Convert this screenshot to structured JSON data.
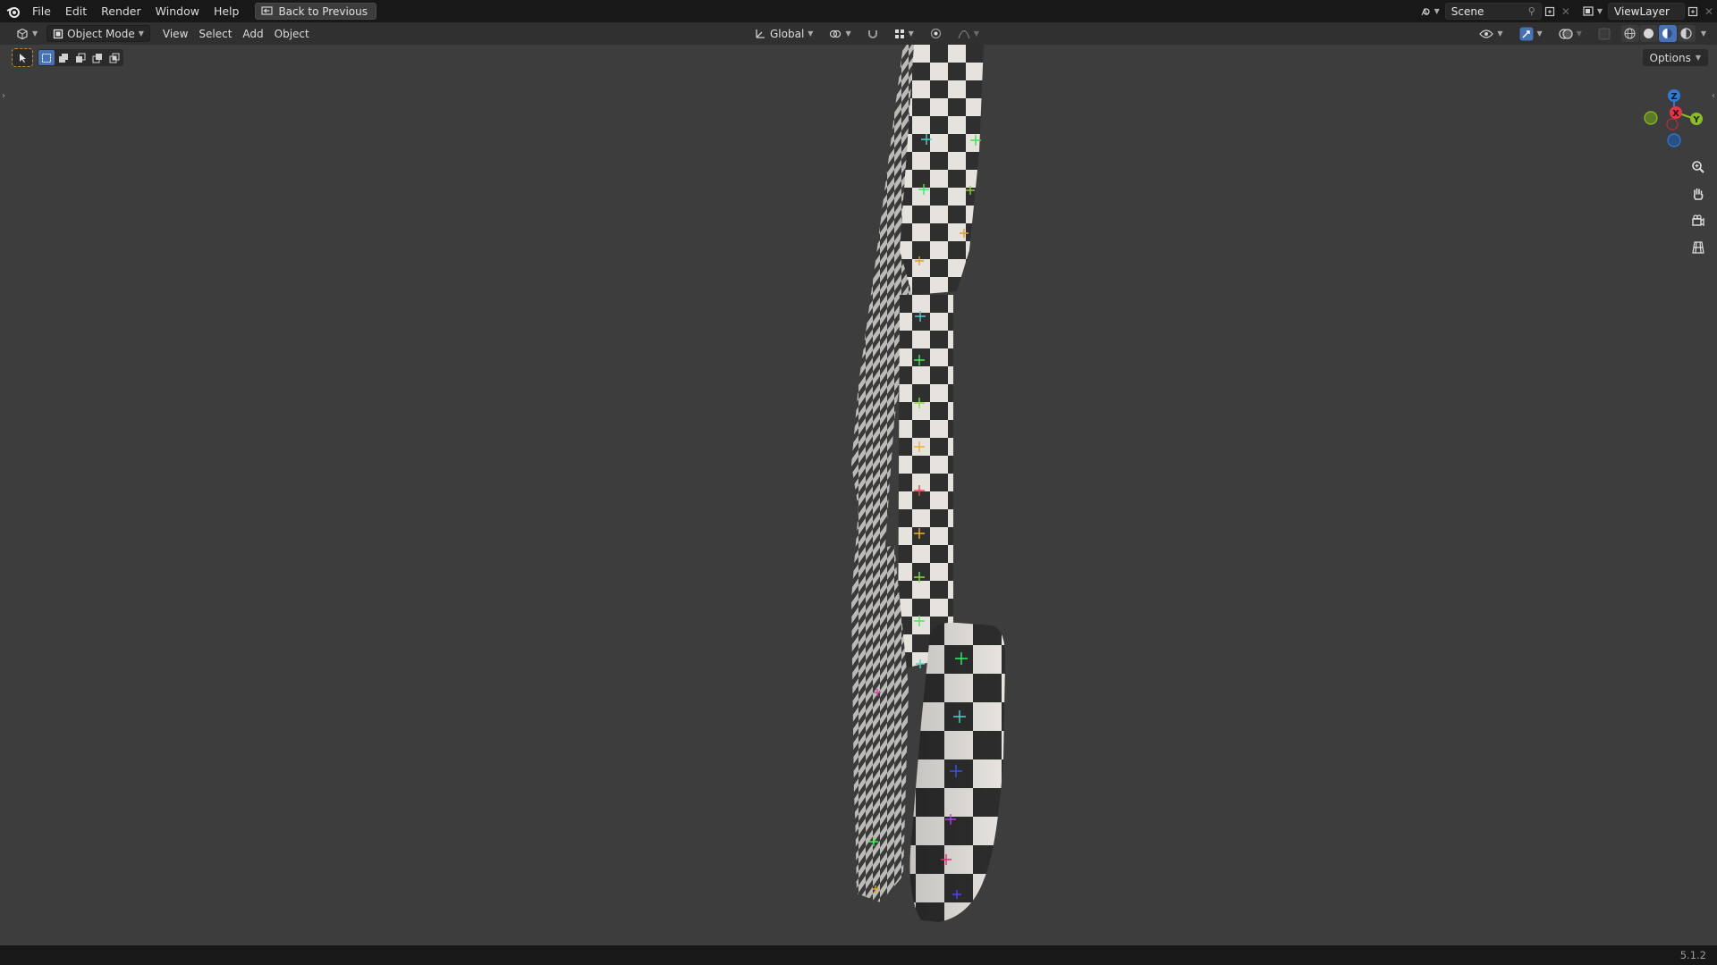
{
  "menu": {
    "items": [
      "File",
      "Edit",
      "Render",
      "Window",
      "Help"
    ],
    "back_to_previous": "Back to Previous"
  },
  "scene": {
    "label": "Scene"
  },
  "view_layer": {
    "label": "ViewLayer"
  },
  "header": {
    "mode": "Object Mode",
    "menus": [
      "View",
      "Select",
      "Add",
      "Object"
    ],
    "transform_orientation": "Global"
  },
  "viewport": {
    "options_label": "Options",
    "gizmo": {
      "z": "Z",
      "x": "X",
      "y": "Y"
    }
  },
  "status": {
    "version": "5.1.2"
  },
  "colors": {
    "accent": "#4772b3",
    "axis_x": "#e2374b",
    "axis_y": "#8bbd2a",
    "axis_z": "#2f7bd8"
  }
}
